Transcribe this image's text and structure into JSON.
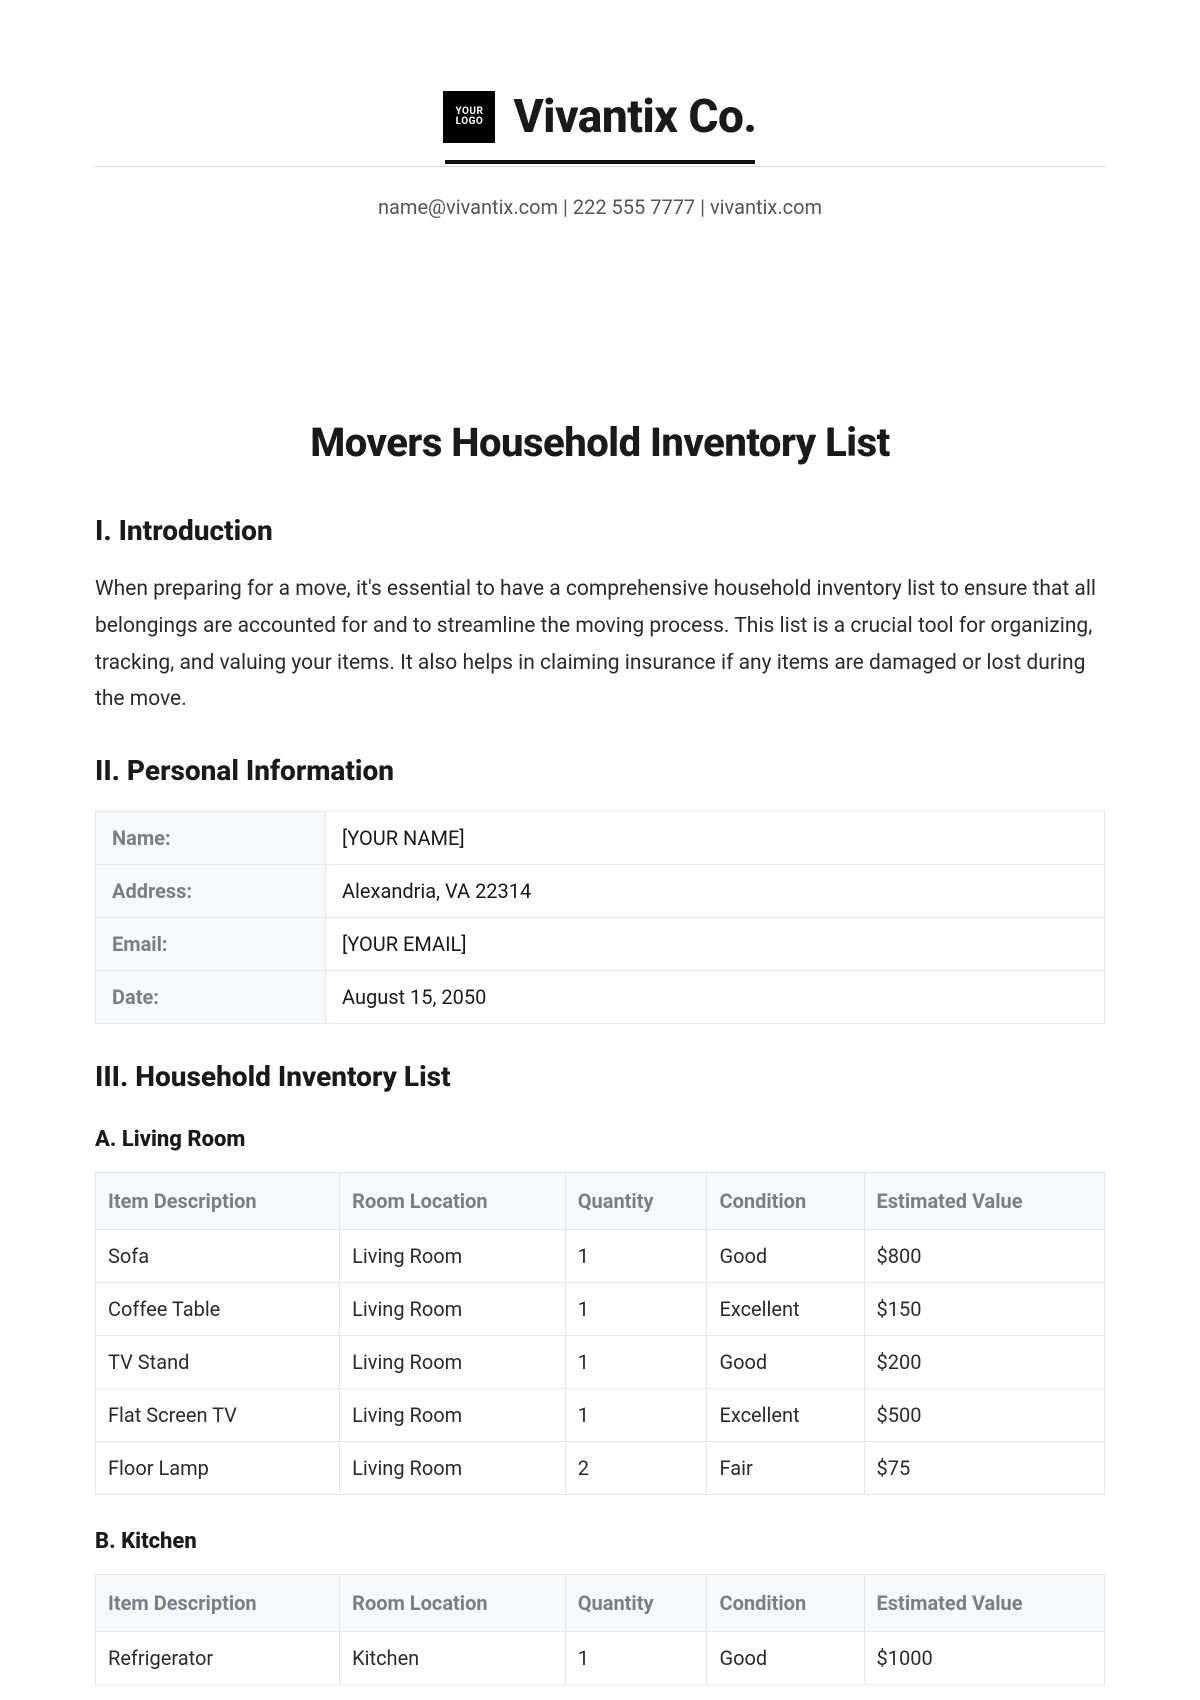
{
  "header": {
    "logo_line1": "YOUR",
    "logo_line2": "LOGO",
    "company": "Vivantix Co.",
    "contact": "name@vivantix.com | 222 555 7777 | vivantix.com"
  },
  "title": "Movers Household Inventory List",
  "sections": {
    "intro_heading": "I. Introduction",
    "intro_text": "When preparing for a move, it's essential to have a comprehensive household inventory list to ensure that all belongings are accounted for and to streamline the moving process. This list is a crucial tool for organizing, tracking, and valuing your items. It also helps in claiming insurance if any items are damaged or lost during the move.",
    "personal_heading": "II. Personal Information",
    "inventory_heading": "III. Household Inventory List",
    "sub_a": "A. Living Room",
    "sub_b": "B. Kitchen"
  },
  "personal": {
    "name_label": "Name:",
    "name_value": "[YOUR NAME]",
    "address_label": "Address:",
    "address_value": "Alexandria, VA 22314",
    "email_label": "Email:",
    "email_value": "[YOUR EMAIL]",
    "date_label": "Date:",
    "date_value": "August 15, 2050"
  },
  "columns": {
    "item": "Item Description",
    "room": "Room Location",
    "qty": "Quantity",
    "cond": "Condition",
    "val": "Estimated Value"
  },
  "living_room": [
    {
      "item": "Sofa",
      "room": "Living Room",
      "qty": "1",
      "cond": "Good",
      "val": "$800"
    },
    {
      "item": "Coffee Table",
      "room": "Living Room",
      "qty": "1",
      "cond": "Excellent",
      "val": "$150"
    },
    {
      "item": "TV Stand",
      "room": "Living Room",
      "qty": "1",
      "cond": "Good",
      "val": "$200"
    },
    {
      "item": "Flat Screen TV",
      "room": "Living Room",
      "qty": "1",
      "cond": "Excellent",
      "val": "$500"
    },
    {
      "item": "Floor Lamp",
      "room": "Living Room",
      "qty": "2",
      "cond": "Fair",
      "val": "$75"
    }
  ],
  "kitchen": [
    {
      "item": "Refrigerator",
      "room": "Kitchen",
      "qty": "1",
      "cond": "Good",
      "val": "$1000"
    }
  ]
}
